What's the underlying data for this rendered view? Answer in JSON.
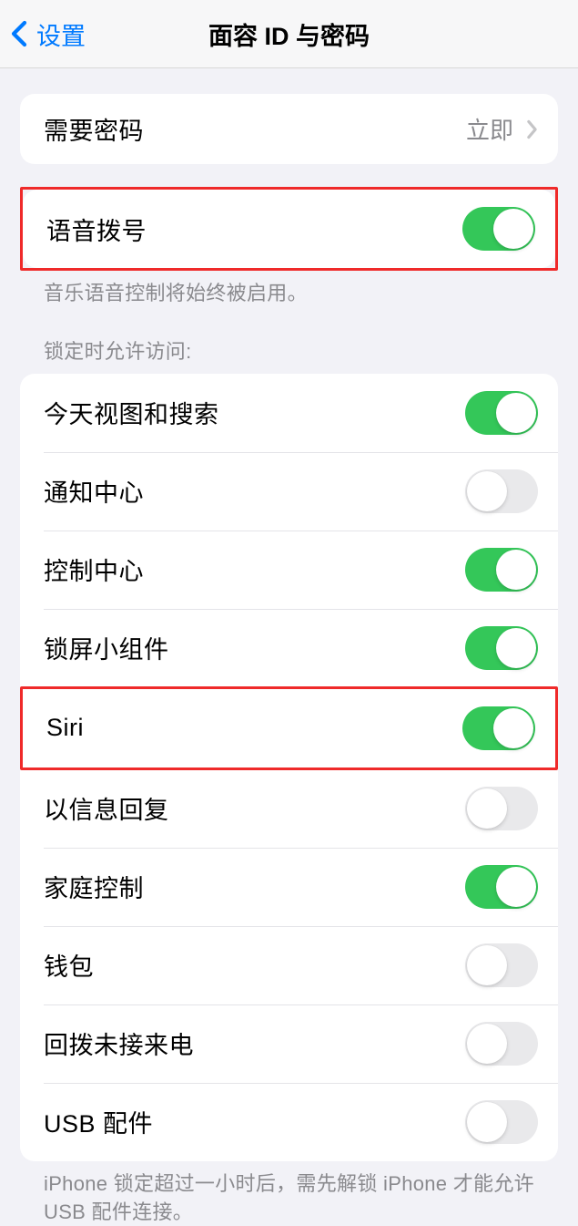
{
  "header": {
    "back_label": "设置",
    "title": "面容 ID 与密码"
  },
  "passcode_row": {
    "label": "需要密码",
    "value": "立即"
  },
  "voice_dial": {
    "label": "语音拨号",
    "on": true,
    "footer": "音乐语音控制将始终被启用。"
  },
  "lock_section": {
    "header": "锁定时允许访问:",
    "items": [
      {
        "label": "今天视图和搜索",
        "on": true
      },
      {
        "label": "通知中心",
        "on": false
      },
      {
        "label": "控制中心",
        "on": true
      },
      {
        "label": "锁屏小组件",
        "on": true
      },
      {
        "label": "Siri",
        "on": true
      },
      {
        "label": "以信息回复",
        "on": false
      },
      {
        "label": "家庭控制",
        "on": true
      },
      {
        "label": "钱包",
        "on": false
      },
      {
        "label": "回拨未接来电",
        "on": false
      },
      {
        "label": "USB 配件",
        "on": false
      }
    ],
    "footer": "iPhone 锁定超过一小时后，需先解锁 iPhone 才能允许USB 配件连接。"
  }
}
